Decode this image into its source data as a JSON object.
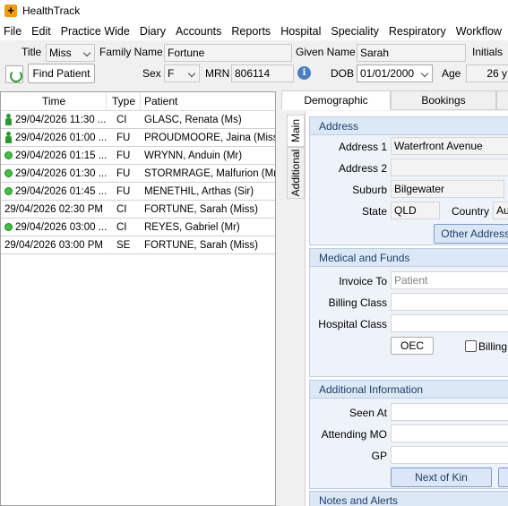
{
  "window": {
    "title": "HealthTrack"
  },
  "menu": [
    "File",
    "Edit",
    "Practice Wide",
    "Diary",
    "Accounts",
    "Reports",
    "Hospital",
    "Speciality",
    "Respiratory",
    "Workflow"
  ],
  "patient_header": {
    "title_label": "Title",
    "title_value": "Miss",
    "family_label": "Family Name",
    "family_value": "Fortune",
    "given_label": "Given Name",
    "given_value": "Sarah",
    "initials_label": "Initials",
    "find_patient_label": "Find Patient",
    "sex_label": "Sex",
    "sex_value": "F",
    "mrn_label": "MRN",
    "mrn_value": "806114",
    "dob_label": "DOB",
    "dob_value": "01/01/2000",
    "age_label": "Age",
    "age_value": "26 y"
  },
  "appointments": {
    "columns": [
      "Time",
      "Type",
      "Patient"
    ],
    "rows": [
      {
        "time": "29/04/2026 11:30 ...",
        "type": "CI",
        "patient": "GLASC, Renata (Ms)",
        "icon": "person-icon"
      },
      {
        "time": "29/04/2026 01:00 ...",
        "type": "FU",
        "patient": "PROUDMOORE, Jaina (Miss)",
        "icon": "person-icon"
      },
      {
        "time": "29/04/2026 01:15 ...",
        "type": "FU",
        "patient": "WRYNN, Anduin (Mr)",
        "icon": "status-dot-icon"
      },
      {
        "time": "29/04/2026 01:30 ...",
        "type": "FU",
        "patient": "STORMRAGE, Malfurion (Mr)",
        "icon": "status-dot-icon"
      },
      {
        "time": "29/04/2026 01:45 ...",
        "type": "FU",
        "patient": "MENETHIL, Arthas (Sir)",
        "icon": "status-dot-icon"
      },
      {
        "time": "29/04/2026 02:30 PM",
        "type": "CI",
        "patient": "FORTUNE, Sarah (Miss)",
        "icon": ""
      },
      {
        "time": "29/04/2026 03:00 ...",
        "type": "CI",
        "patient": "REYES, Gabriel (Mr)",
        "icon": "status-dot-icon"
      },
      {
        "time": "29/04/2026 03:00 PM",
        "type": "SE",
        "patient": "FORTUNE, Sarah (Miss)",
        "icon": ""
      }
    ]
  },
  "tabs": {
    "demographic": "Demographic",
    "bookings": "Bookings"
  },
  "side_tabs": {
    "main": "Main",
    "additional": "Additional"
  },
  "address": {
    "heading": "Address",
    "address1_label": "Address 1",
    "address1_value": "Waterfront Avenue",
    "address2_label": "Address 2",
    "address2_value": "",
    "suburb_label": "Suburb",
    "suburb_value": "Bilgewater",
    "state_label": "State",
    "state_value": "QLD",
    "country_label": "Country",
    "country_value": "Aus",
    "other_addresses_label": "Other Addresses"
  },
  "medical": {
    "heading": "Medical and Funds",
    "invoice_label": "Invoice To",
    "invoice_placeholder": "Patient",
    "billing_class_label": "Billing Class",
    "hospital_class_label": "Hospital Class",
    "oec_label": "OEC",
    "billing_checkbox_label": "Billing A"
  },
  "additional_info": {
    "heading": "Additional Information",
    "seen_at_label": "Seen At",
    "attending_label": "Attending MO",
    "gp_label": "GP",
    "next_of_kin_label": "Next of Kin"
  },
  "notes": {
    "heading": "Notes and Alerts"
  },
  "colors": {
    "accent": "#f39c12",
    "status_green": "#3cc43c",
    "section_blue": "#dce8f5"
  }
}
